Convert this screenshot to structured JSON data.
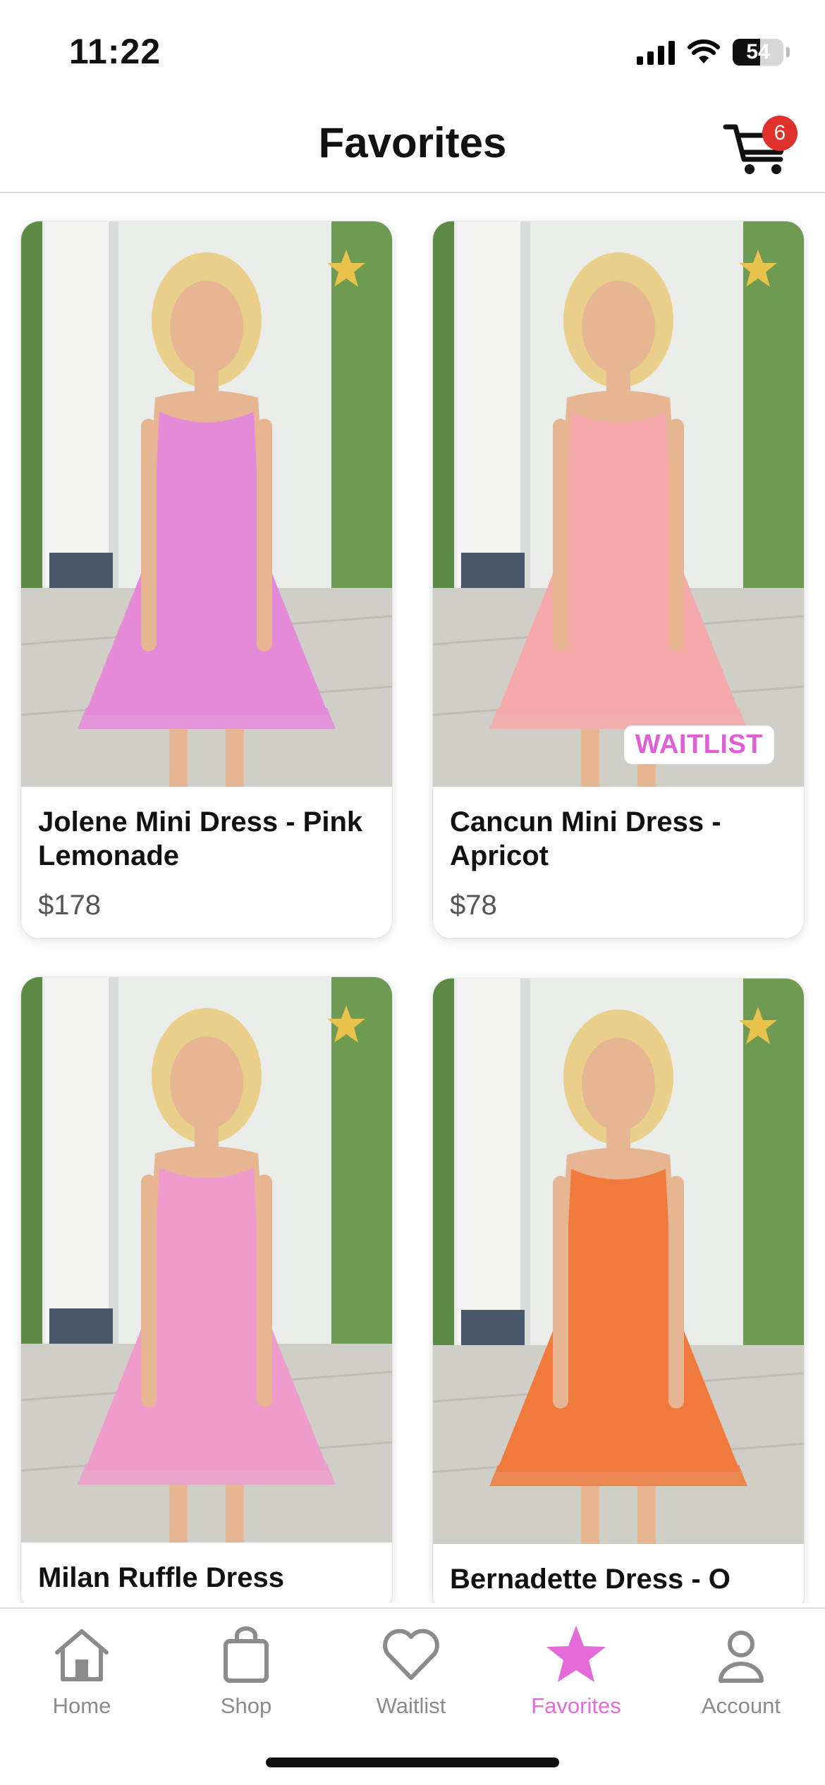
{
  "status": {
    "time": "11:22",
    "battery": "54",
    "battery_level": 0.54
  },
  "header": {
    "title": "Favorites",
    "cart_count": "6",
    "cart_icon": "cart-icon"
  },
  "products": [
    {
      "name": "Jolene Mini Dress - Pink Lemonade",
      "price": "$178",
      "favorited": true,
      "badge": "",
      "dress_color": "#e58ad8"
    },
    {
      "name": "Cancun Mini Dress - Apricot",
      "price": "$78",
      "favorited": true,
      "badge": "WAITLIST",
      "dress_color": "#f6a9a9"
    },
    {
      "name": "Milan Ruffle Dress",
      "price": "",
      "favorited": true,
      "badge": "",
      "dress_color": "#ef9ccc"
    },
    {
      "name": "Bernadette Dress - O",
      "price": "",
      "favorited": true,
      "badge": "",
      "dress_color": "#f07a3c"
    }
  ],
  "tabs": [
    {
      "label": "Home",
      "icon": "home-icon",
      "active": false
    },
    {
      "label": "Shop",
      "icon": "bag-icon",
      "active": false
    },
    {
      "label": "Waitlist",
      "icon": "heart-icon",
      "active": false
    },
    {
      "label": "Favorites",
      "icon": "star-icon",
      "active": true
    },
    {
      "label": "Account",
      "icon": "person-icon",
      "active": false
    }
  ],
  "colors": {
    "accent": "#e36ad8",
    "badge_red": "#e0302a",
    "star_gold": "#e8c24a",
    "inactive_gray": "#8b8b8b"
  }
}
